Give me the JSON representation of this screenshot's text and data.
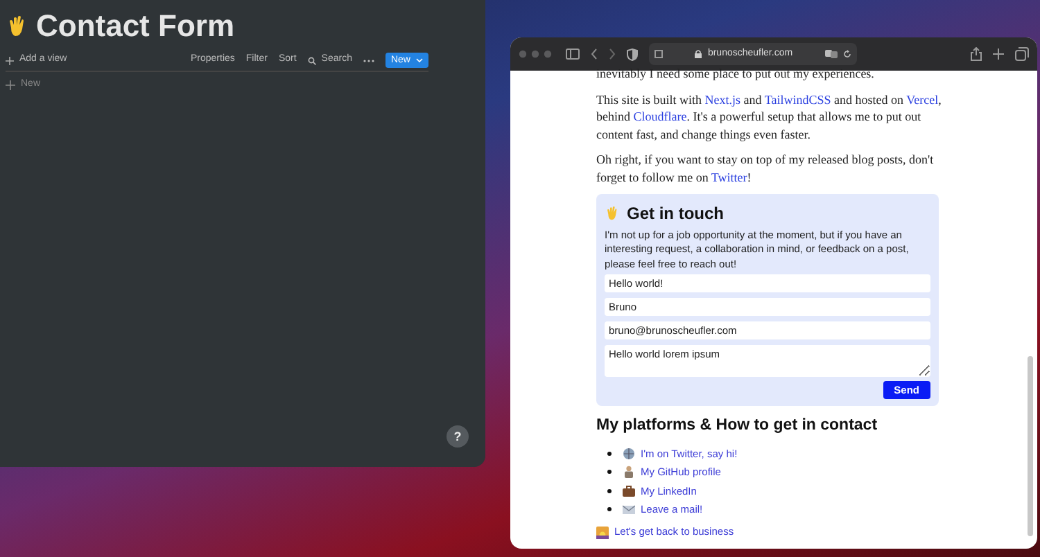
{
  "notion": {
    "title": "Contact Form",
    "add_view": "Add a view",
    "toolbar": [
      "Properties",
      "Filter",
      "Sort",
      "Search"
    ],
    "new_button": "New",
    "new_row": "New",
    "help": "?"
  },
  "browser": {
    "url": "brunoscheufler.com",
    "paragraphs": [
      [
        {
          "text": "inevitably I need some place to put out my experiences."
        }
      ],
      [
        {
          "text": "This site is built with "
        },
        {
          "text": "Next.js",
          "link": true
        },
        {
          "text": " and "
        },
        {
          "text": "TailwindCSS",
          "link": true
        },
        {
          "text": " and hosted on "
        },
        {
          "text": "Vercel",
          "link": true
        },
        {
          "text": ", behind "
        },
        {
          "text": "Cloudflare",
          "link": true
        },
        {
          "text": ". It's a powerful setup that allows me to put out content fast, and change things even faster."
        }
      ],
      [
        {
          "text": "Oh right, if you want to stay on top of my released blog posts, don't forget to follow me on "
        },
        {
          "text": "Twitter",
          "link": true
        },
        {
          "text": "!"
        }
      ]
    ],
    "contact": {
      "title": "Get in touch",
      "text": "I'm not up for a job opportunity at the moment, but if you have an interesting request, a collaboration in mind, or feedback on a post, please feel free to reach out!",
      "fields": [
        {
          "kind": "input",
          "value": "Hello world!"
        },
        {
          "kind": "input",
          "value": "Bruno"
        },
        {
          "kind": "input",
          "value": "bruno@brunoscheufler.com"
        },
        {
          "kind": "textarea",
          "value": "Hello world lorem ipsum"
        }
      ],
      "send": "Send"
    },
    "platforms": {
      "title": "My platforms & How to get in contact",
      "items": [
        {
          "kind": "globe",
          "label": "I'm on Twitter, say hi!"
        },
        {
          "kind": "figure",
          "label": "My GitHub profile"
        },
        {
          "kind": "briefcase",
          "label": "My LinkedIn"
        },
        {
          "kind": "envelope",
          "label": "Leave a mail!"
        }
      ],
      "back": "Let's get back to business"
    }
  }
}
